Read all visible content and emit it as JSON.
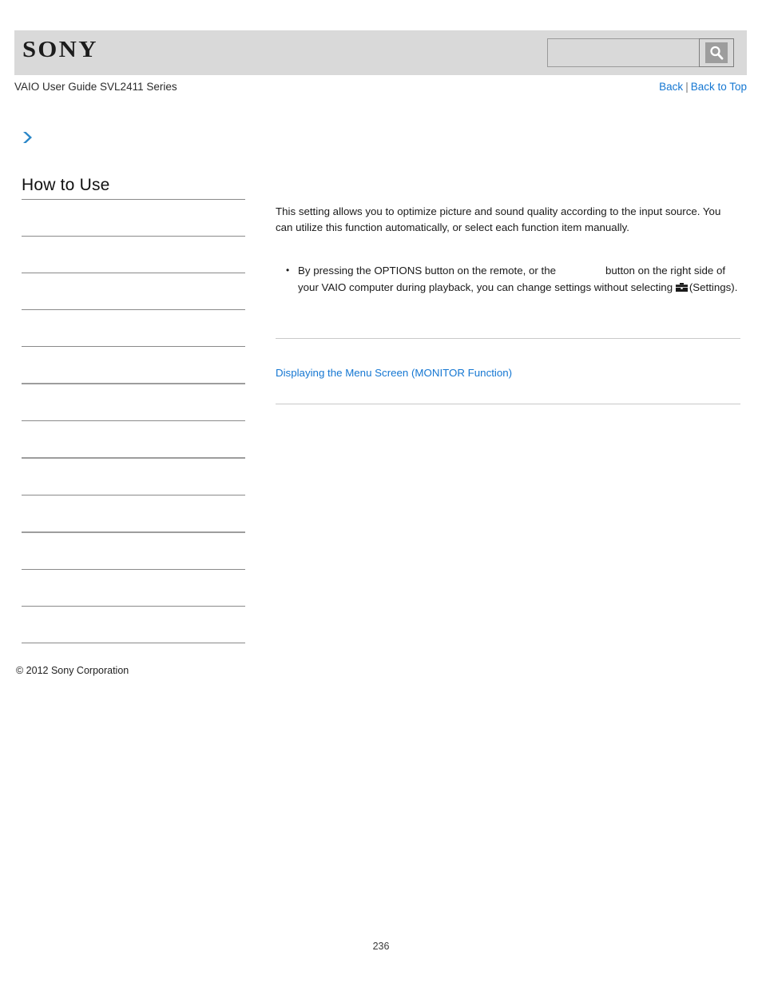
{
  "document": {
    "page_number": "236",
    "copyright": "© 2012 Sony Corporation"
  },
  "header": {
    "brand": "SONY",
    "brand_icon": "sony-logo",
    "search": {
      "value": "",
      "placeholder": "",
      "button_icon": "search-magnifier-icon"
    }
  },
  "topbar": {
    "guide_title": "VAIO User Guide SVL2411 Series",
    "back_label": "Back",
    "separator": "|",
    "back_to_top_label": "Back to Top"
  },
  "breadcrumb": {
    "icon": "chevron-right-icon",
    "label": ""
  },
  "sidebar": {
    "title": "How to Use",
    "items": [
      {
        "label": "",
        "rule": "thin"
      },
      {
        "label": "",
        "rule": "thin"
      },
      {
        "label": "",
        "rule": "thin"
      },
      {
        "label": "",
        "rule": "thin"
      },
      {
        "label": "",
        "rule": "thin"
      },
      {
        "label": "",
        "rule": "thick"
      },
      {
        "label": "",
        "rule": "thin"
      },
      {
        "label": "",
        "rule": "thick"
      },
      {
        "label": "",
        "rule": "thin"
      },
      {
        "label": "",
        "rule": "thick"
      },
      {
        "label": "",
        "rule": "thin"
      },
      {
        "label": "",
        "rule": "thin"
      },
      {
        "label": "",
        "rule": "thin"
      }
    ]
  },
  "main": {
    "intro_line_1": "This setting allows you to optimize picture and sound quality according to the input source.",
    "intro_line_2": "You can utilize this function automatically, or select each function item manually.",
    "note_text_before": "By pressing the OPTIONS button on the remote, or the",
    "note_text_middle": "button on the right side of your VAIO computer during playback, you can change settings without selecting",
    "note_icon": "toolbox-settings-icon",
    "note_text_after": "(Settings).",
    "related_link": "Displaying the Menu Screen (MONITOR Function)"
  },
  "colors": {
    "header_gray": "#d9d9d9",
    "link_blue": "#1577d2",
    "chevron_blue": "#2b87c8",
    "rule_gray": "#8a8a8a",
    "content_rule_gray": "#c9c9c9"
  }
}
